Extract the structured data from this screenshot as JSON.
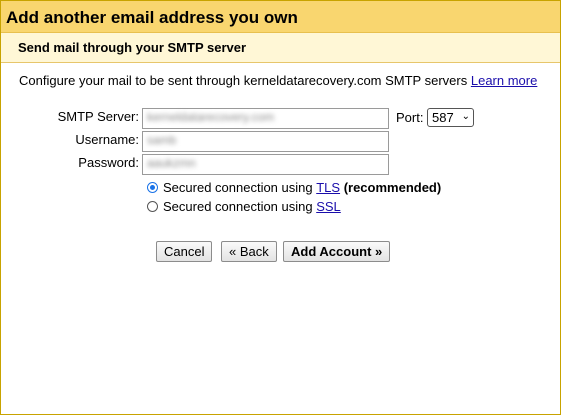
{
  "dialog": {
    "title": "Add another email address you own",
    "section_title": "Send mail through your SMTP server",
    "description_prefix": "Configure your mail to be sent through kerneldatarecovery.com SMTP servers",
    "learn_more": "Learn more"
  },
  "form": {
    "smtp_server_label": "SMTP Server:",
    "smtp_server_value": "kerneldatarecovery.com",
    "port_label": "Port:",
    "port_value": "587",
    "username_label": "Username:",
    "username_value": "samb",
    "password_label": "Password:",
    "password_value": "aaukzmn"
  },
  "security": {
    "tls_prefix": "Secured connection using ",
    "tls_link": "TLS",
    "tls_suffix": "(recommended)",
    "ssl_prefix": "Secured connection using ",
    "ssl_link": "SSL",
    "selected": "tls"
  },
  "buttons": {
    "cancel": "Cancel",
    "back": "« Back",
    "add_account": "Add Account »"
  },
  "colors": {
    "title_bar": "#f9d66f",
    "section_bg": "#fff7d6",
    "link": "#1a0dab",
    "radio_accent": "#1a73e8"
  }
}
